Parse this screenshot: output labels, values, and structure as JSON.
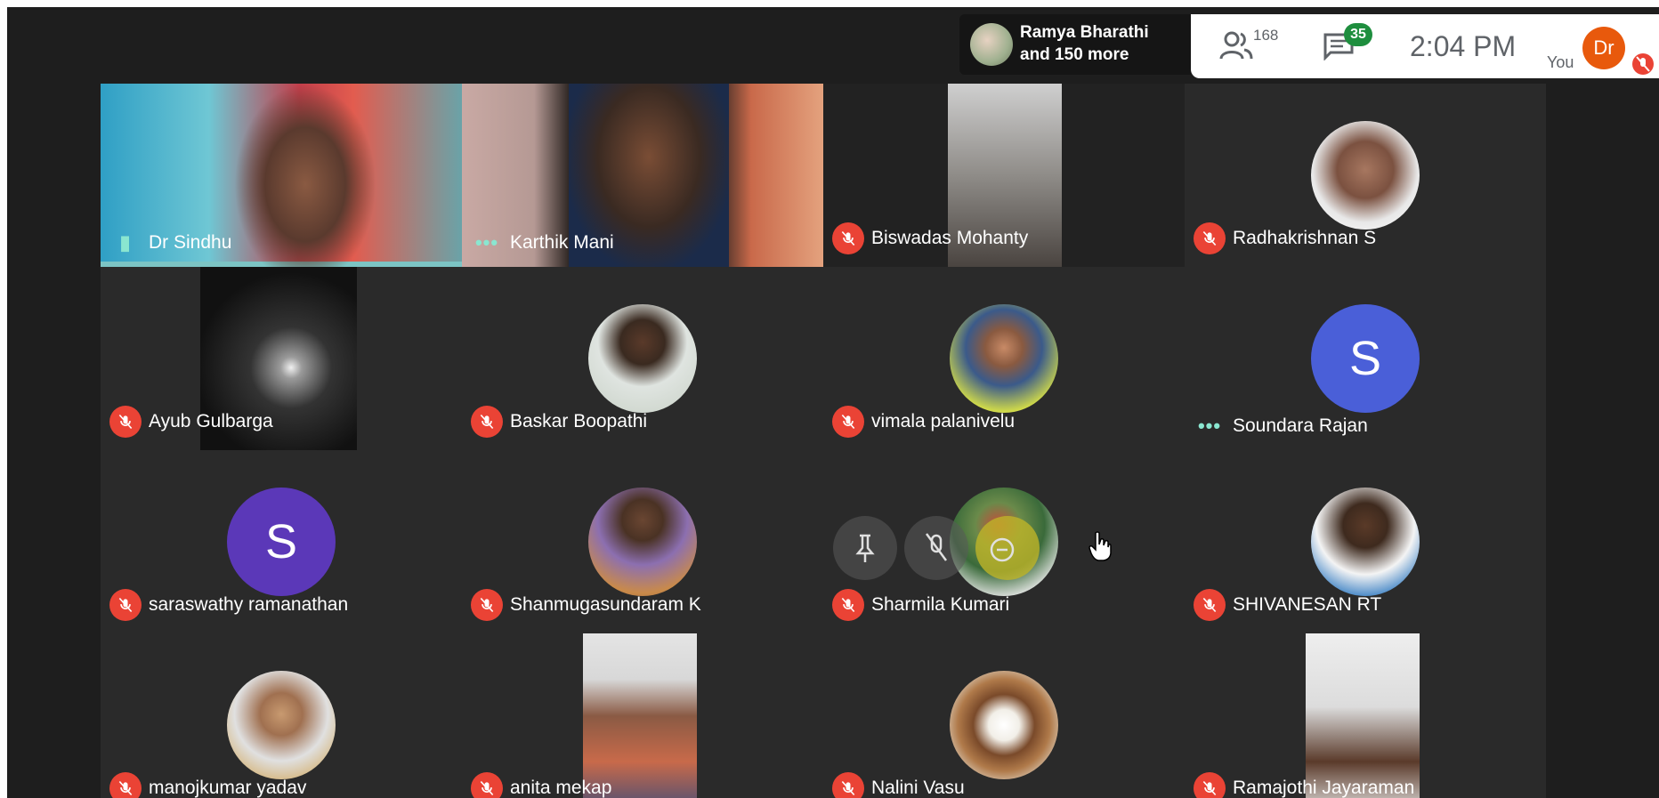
{
  "header": {
    "speaker_name": "Ramya Bharathi",
    "speaker_more": "and 150 more",
    "people_count": "168",
    "chat_badge": "35",
    "clock": "2:04 PM",
    "you_label": "You",
    "self_initials": "Dr"
  },
  "tiles": [
    {
      "name": "Dr Sindhu",
      "status": "speaking"
    },
    {
      "name": "Karthik Mani",
      "status": "dots"
    },
    {
      "name": "Biswadas Mohanty",
      "status": "muted"
    },
    {
      "name": "Radhakrishnan S",
      "status": "muted"
    },
    {
      "name": "Ayub Gulbarga",
      "status": "muted"
    },
    {
      "name": "Baskar Boopathi",
      "status": "muted"
    },
    {
      "name": "vimala palanivelu",
      "status": "muted"
    },
    {
      "name": "Soundara Rajan",
      "status": "dots",
      "avatar_letter": "S"
    },
    {
      "name": "saraswathy ramanathan",
      "status": "muted",
      "avatar_letter": "S"
    },
    {
      "name": "Shanmugasundaram K",
      "status": "muted"
    },
    {
      "name": "Sharmila Kumari",
      "status": "muted"
    },
    {
      "name": "SHIVANESAN RT",
      "status": "muted"
    },
    {
      "name": "manojkumar yadav",
      "status": "muted"
    },
    {
      "name": "anita mekap",
      "status": "muted"
    },
    {
      "name": "Nalini Vasu",
      "status": "muted"
    },
    {
      "name": "Ramajothi Jayaraman",
      "status": "muted"
    }
  ],
  "colors": {
    "mute_red": "#ea4335",
    "letter_avatar_blue": "#4a5fd8",
    "letter_avatar_purple": "#5b38b8",
    "speaking_teal": "#7cc4c4",
    "chat_green": "#1e8e3e"
  }
}
